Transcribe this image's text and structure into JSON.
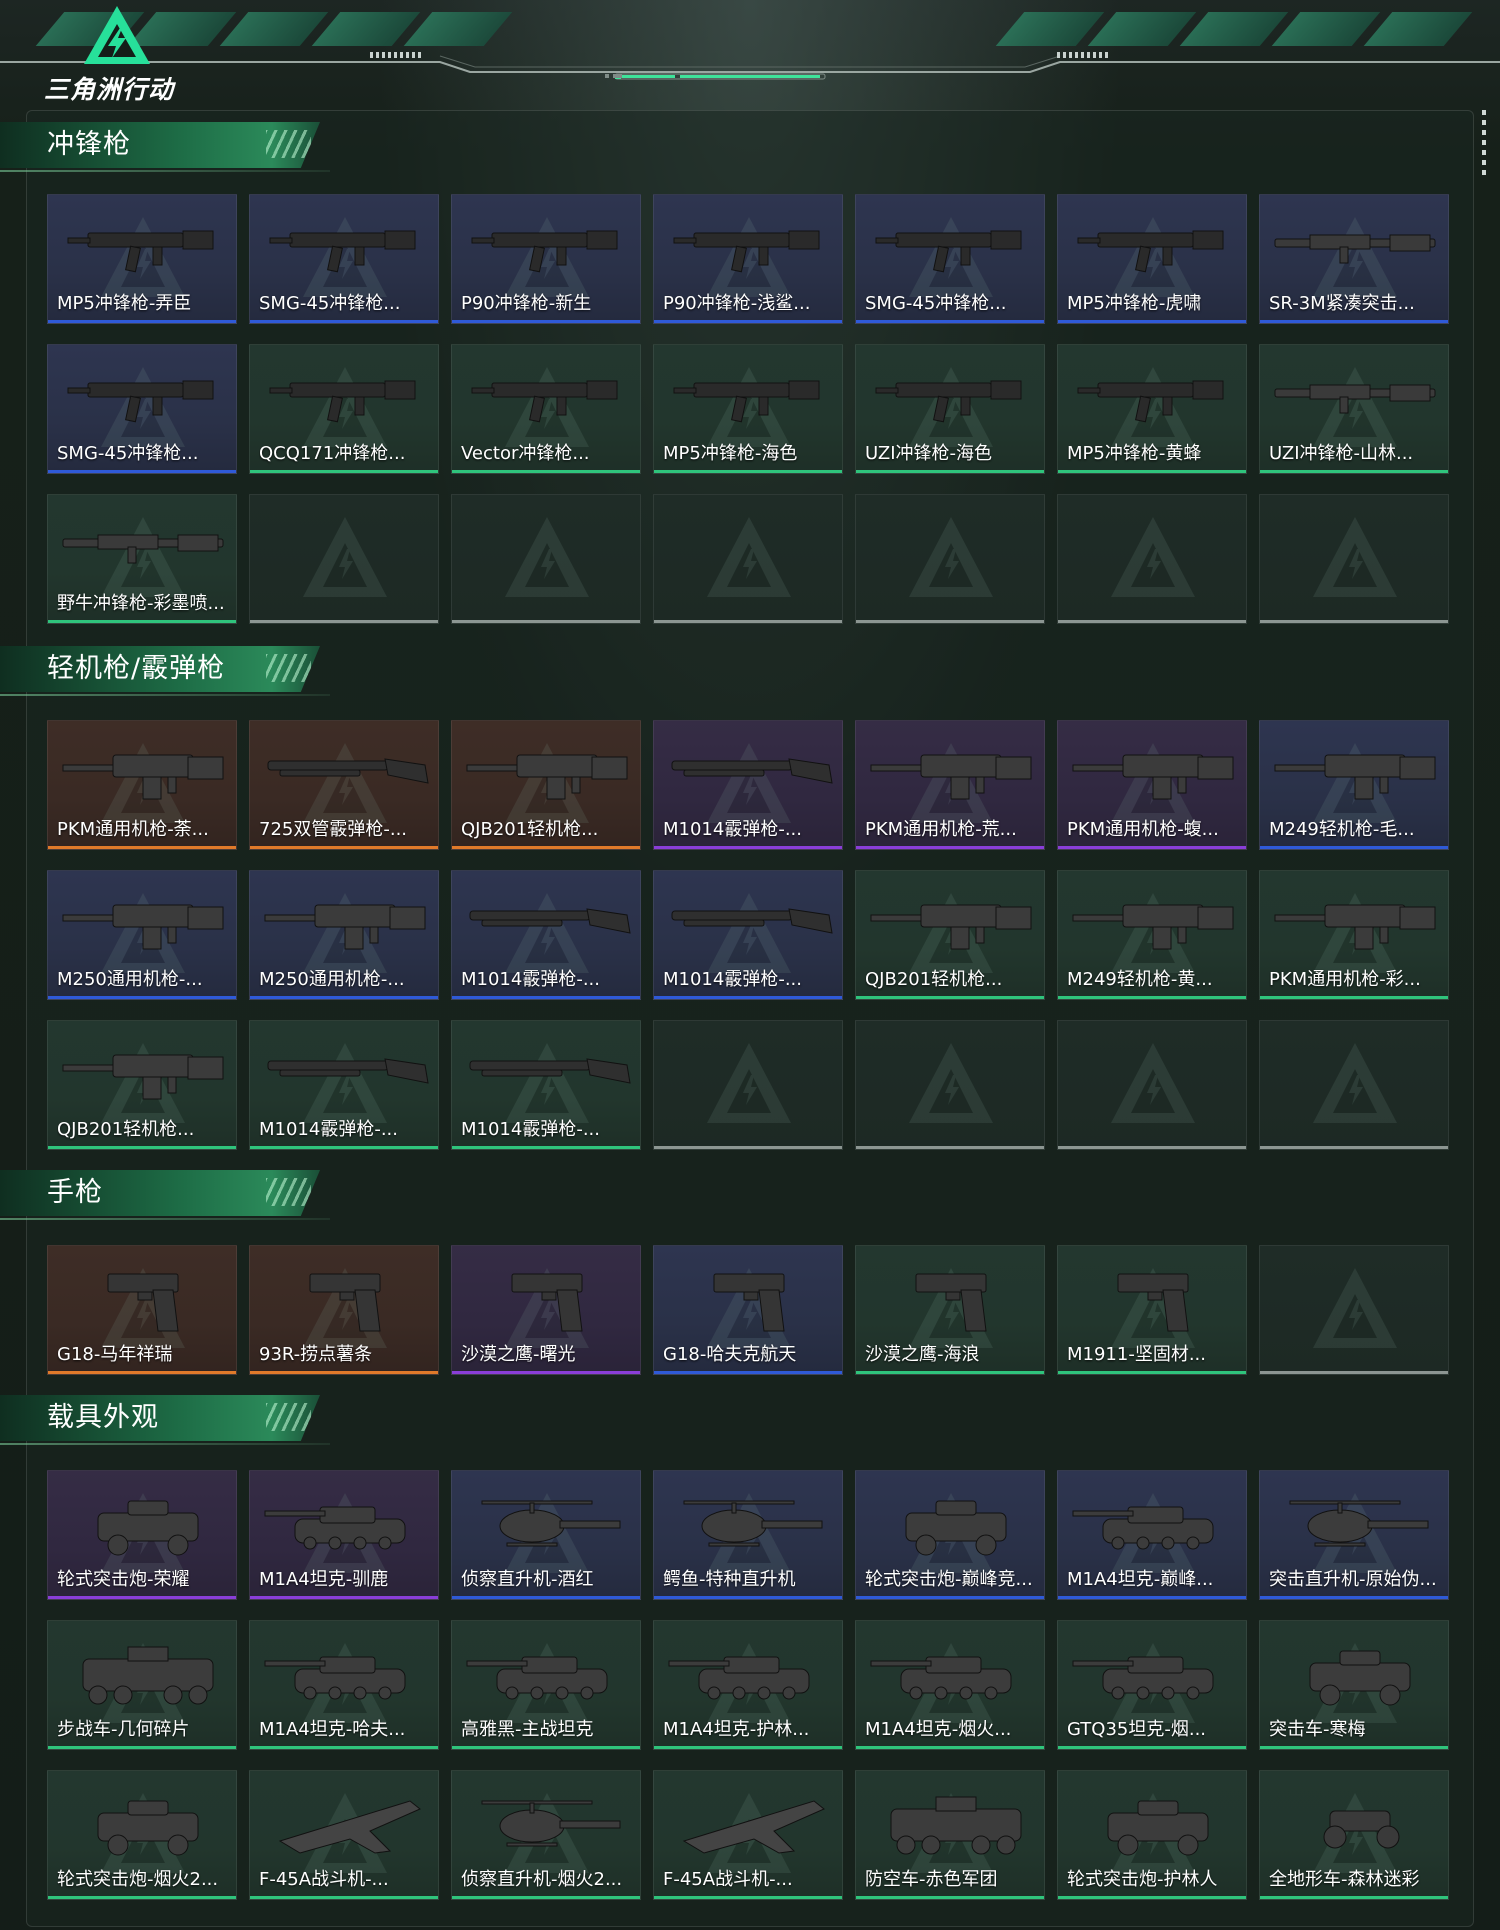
{
  "header": {
    "logo_text": "三角洲行动"
  },
  "colors": {
    "accent": "#2fc47c",
    "rarity_blue": "#2f5ad8",
    "rarity_green": "#2fc47c",
    "rarity_purple": "#8a3ed8",
    "rarity_orange": "#e07a2a",
    "empty": "#8c9692"
  },
  "sections": [
    {
      "title": "冲锋枪",
      "items": [
        {
          "label": "MP5冲锋枪-弄臣",
          "rarity": "blue",
          "icon": "smg-icon"
        },
        {
          "label": "SMG-45冲锋枪...",
          "rarity": "blue",
          "icon": "smg-icon"
        },
        {
          "label": "P90冲锋枪-新生",
          "rarity": "blue",
          "icon": "smg-icon"
        },
        {
          "label": "P90冲锋枪-浅鲨...",
          "rarity": "blue",
          "icon": "smg-icon"
        },
        {
          "label": "SMG-45冲锋枪...",
          "rarity": "blue",
          "icon": "smg-icon"
        },
        {
          "label": "MP5冲锋枪-虎啸",
          "rarity": "blue",
          "icon": "smg-icon"
        },
        {
          "label": "SR-3M紧凑突击...",
          "rarity": "blue",
          "icon": "rifle-icon"
        },
        {
          "label": "SMG-45冲锋枪...",
          "rarity": "blue",
          "icon": "smg-icon"
        },
        {
          "label": "QCQ171冲锋枪...",
          "rarity": "green",
          "icon": "smg-icon"
        },
        {
          "label": "Vector冲锋枪...",
          "rarity": "green",
          "icon": "smg-icon"
        },
        {
          "label": "MP5冲锋枪-海色",
          "rarity": "green",
          "icon": "smg-icon"
        },
        {
          "label": "UZI冲锋枪-海色",
          "rarity": "green",
          "icon": "smg-icon"
        },
        {
          "label": "MP5冲锋枪-黄蜂",
          "rarity": "green",
          "icon": "smg-icon"
        },
        {
          "label": "UZI冲锋枪-山林...",
          "rarity": "green",
          "icon": "rifle-icon"
        },
        {
          "label": "野牛冲锋枪-彩墨喷...",
          "rarity": "green",
          "icon": "rifle-icon"
        },
        {
          "label": "",
          "rarity": "empty",
          "icon": ""
        },
        {
          "label": "",
          "rarity": "empty",
          "icon": ""
        },
        {
          "label": "",
          "rarity": "empty",
          "icon": ""
        },
        {
          "label": "",
          "rarity": "empty",
          "icon": ""
        },
        {
          "label": "",
          "rarity": "empty",
          "icon": ""
        },
        {
          "label": "",
          "rarity": "empty",
          "icon": ""
        }
      ]
    },
    {
      "title": "轻机枪/霰弹枪",
      "items": [
        {
          "label": "PKM通用机枪-荼...",
          "rarity": "orange",
          "icon": "machine-gun-icon"
        },
        {
          "label": "725双管霰弹枪-...",
          "rarity": "orange",
          "icon": "shotgun-icon"
        },
        {
          "label": "QJB201轻机枪...",
          "rarity": "orange",
          "icon": "machine-gun-icon"
        },
        {
          "label": "M1014霰弹枪-...",
          "rarity": "purple",
          "icon": "shotgun-icon"
        },
        {
          "label": "PKM通用机枪-荒...",
          "rarity": "purple",
          "icon": "machine-gun-icon"
        },
        {
          "label": "PKM通用机枪-蝮...",
          "rarity": "purple",
          "icon": "machine-gun-icon"
        },
        {
          "label": "M249轻机枪-毛...",
          "rarity": "blue",
          "icon": "machine-gun-icon"
        },
        {
          "label": "M250通用机枪-...",
          "rarity": "blue",
          "icon": "machine-gun-icon"
        },
        {
          "label": "M250通用机枪-...",
          "rarity": "blue",
          "icon": "machine-gun-icon"
        },
        {
          "label": "M1014霰弹枪-...",
          "rarity": "blue",
          "icon": "shotgun-icon"
        },
        {
          "label": "M1014霰弹枪-...",
          "rarity": "blue",
          "icon": "shotgun-icon"
        },
        {
          "label": "QJB201轻机枪...",
          "rarity": "green",
          "icon": "machine-gun-icon"
        },
        {
          "label": "M249轻机枪-黄...",
          "rarity": "green",
          "icon": "machine-gun-icon"
        },
        {
          "label": "PKM通用机枪-彩...",
          "rarity": "green",
          "icon": "machine-gun-icon"
        },
        {
          "label": "QJB201轻机枪...",
          "rarity": "green",
          "icon": "machine-gun-icon"
        },
        {
          "label": "M1014霰弹枪-...",
          "rarity": "green",
          "icon": "shotgun-icon"
        },
        {
          "label": "M1014霰弹枪-...",
          "rarity": "green",
          "icon": "shotgun-icon"
        },
        {
          "label": "",
          "rarity": "empty",
          "icon": ""
        },
        {
          "label": "",
          "rarity": "empty",
          "icon": ""
        },
        {
          "label": "",
          "rarity": "empty",
          "icon": ""
        },
        {
          "label": "",
          "rarity": "empty",
          "icon": ""
        }
      ]
    },
    {
      "title": "手枪",
      "items": [
        {
          "label": "G18-马年祥瑞",
          "rarity": "orange",
          "icon": "pistol-icon"
        },
        {
          "label": "93R-捞点薯条",
          "rarity": "orange",
          "icon": "pistol-icon"
        },
        {
          "label": "沙漠之鹰-曙光",
          "rarity": "purple",
          "icon": "pistol-icon"
        },
        {
          "label": "G18-哈夫克航天",
          "rarity": "blue",
          "icon": "pistol-icon"
        },
        {
          "label": "沙漠之鹰-海浪",
          "rarity": "green",
          "icon": "pistol-icon"
        },
        {
          "label": "M1911-坚固材...",
          "rarity": "green",
          "icon": "pistol-icon"
        },
        {
          "label": "",
          "rarity": "empty",
          "icon": ""
        }
      ]
    },
    {
      "title": "载具外观",
      "items": [
        {
          "label": "轮式突击炮-荣耀",
          "rarity": "purple",
          "icon": "armored-car-icon"
        },
        {
          "label": "M1A4坦克-驯鹿",
          "rarity": "purple",
          "icon": "tank-icon"
        },
        {
          "label": "侦察直升机-酒红",
          "rarity": "blue",
          "icon": "helicopter-icon"
        },
        {
          "label": "鳄鱼-特种直升机",
          "rarity": "blue",
          "icon": "helicopter-icon"
        },
        {
          "label": "轮式突击炮-巅峰竞...",
          "rarity": "blue",
          "icon": "armored-car-icon"
        },
        {
          "label": "M1A4坦克-巅峰...",
          "rarity": "blue",
          "icon": "tank-icon"
        },
        {
          "label": "突击直升机-原始伪...",
          "rarity": "blue",
          "icon": "helicopter-icon"
        },
        {
          "label": "步战车-几何碎片",
          "rarity": "green",
          "icon": "ifv-icon"
        },
        {
          "label": "M1A4坦克-哈夫...",
          "rarity": "green",
          "icon": "tank-icon"
        },
        {
          "label": "高雅黑-主战坦克",
          "rarity": "green",
          "icon": "tank-icon"
        },
        {
          "label": "M1A4坦克-护林...",
          "rarity": "green",
          "icon": "tank-icon"
        },
        {
          "label": "M1A4坦克-烟火...",
          "rarity": "green",
          "icon": "tank-icon"
        },
        {
          "label": "GTQ35坦克-烟...",
          "rarity": "green",
          "icon": "tank-icon"
        },
        {
          "label": "突击车-寒梅",
          "rarity": "green",
          "icon": "armored-car-icon"
        },
        {
          "label": "轮式突击炮-烟火2...",
          "rarity": "green",
          "icon": "armored-car-icon"
        },
        {
          "label": "F-45A战斗机-...",
          "rarity": "green",
          "icon": "jet-icon"
        },
        {
          "label": "侦察直升机-烟火2...",
          "rarity": "green",
          "icon": "helicopter-icon"
        },
        {
          "label": "F-45A战斗机-...",
          "rarity": "green",
          "icon": "jet-icon"
        },
        {
          "label": "防空车-赤色军团",
          "rarity": "green",
          "icon": "ifv-icon"
        },
        {
          "label": "轮式突击炮-护林人",
          "rarity": "green",
          "icon": "armored-car-icon"
        },
        {
          "label": "全地形车-森林迷彩",
          "rarity": "green",
          "icon": "atv-icon"
        }
      ]
    }
  ]
}
